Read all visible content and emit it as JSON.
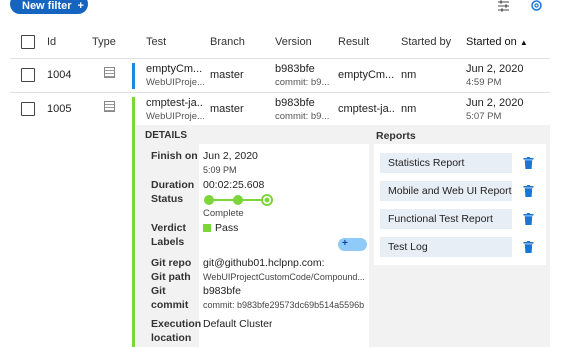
{
  "toolbar": {
    "new_filter_label": "New filter",
    "new_filter_plus": "+"
  },
  "table": {
    "headers": {
      "id": "Id",
      "type": "Type",
      "test": "Test",
      "branch": "Branch",
      "version": "Version",
      "result": "Result",
      "started_by": "Started by",
      "started_on": "Started on",
      "sort_indicator": "▲"
    },
    "rows": [
      {
        "id": "1004",
        "test": "emptyCm...",
        "test_sub": "WebUIProje...",
        "branch": "master",
        "version": "b983bfe",
        "version_sub": "commit: b9...",
        "result": "emptyCm...",
        "started_by": "nm",
        "started_on": "Jun 2, 2020",
        "started_on_time": "4:59 PM",
        "marker_color": "#1e88e5"
      },
      {
        "id": "1005",
        "test": "cmptest-ja...",
        "test_sub": "WebUIProje...",
        "branch": "master",
        "version": "b983bfe",
        "version_sub": "commit: b9...",
        "result": "cmptest-ja...",
        "started_by": "nm",
        "started_on": "Jun 2, 2020",
        "started_on_time": "5:07 PM",
        "marker_color": "#7cd63a"
      }
    ]
  },
  "details": {
    "title": "DETAILS",
    "finish_on_label": "Finish on",
    "finish_on_date": "Jun 2, 2020",
    "finish_on_time": "5:09 PM",
    "duration_label": "Duration",
    "duration_value": "00:02:25.608",
    "status_label": "Status",
    "status_value": "Complete",
    "status_progress": 1.0,
    "verdict_label": "Verdict",
    "verdict_value": "Pass",
    "verdict_color": "#7cd63a",
    "labels_label": "Labels",
    "labels_add": "+",
    "git_repo_label": "Git repo",
    "git_repo_value": "git@github01.hclpnp.com:",
    "git_path_label": "Git path",
    "git_path_value": "WebUIProjectCustomCode/Compound...",
    "git_commit_label_1": "Git",
    "git_commit_label_2": "commit",
    "git_commit_value": "b983bfe",
    "git_commit_sub": "commit: b983bfe29573dc69b514a5596b",
    "execution_label_1": "Execution",
    "execution_label_2": "location",
    "execution_value": "Default Cluster"
  },
  "reports": {
    "title": "Reports",
    "items": [
      "Statistics Report",
      "Mobile and Web UI Report",
      "Functional Test Report",
      "Test Log"
    ]
  },
  "colors": {
    "accent": "#1565c0",
    "status_green": "#7cd63a",
    "trash_blue": "#1976d2"
  }
}
